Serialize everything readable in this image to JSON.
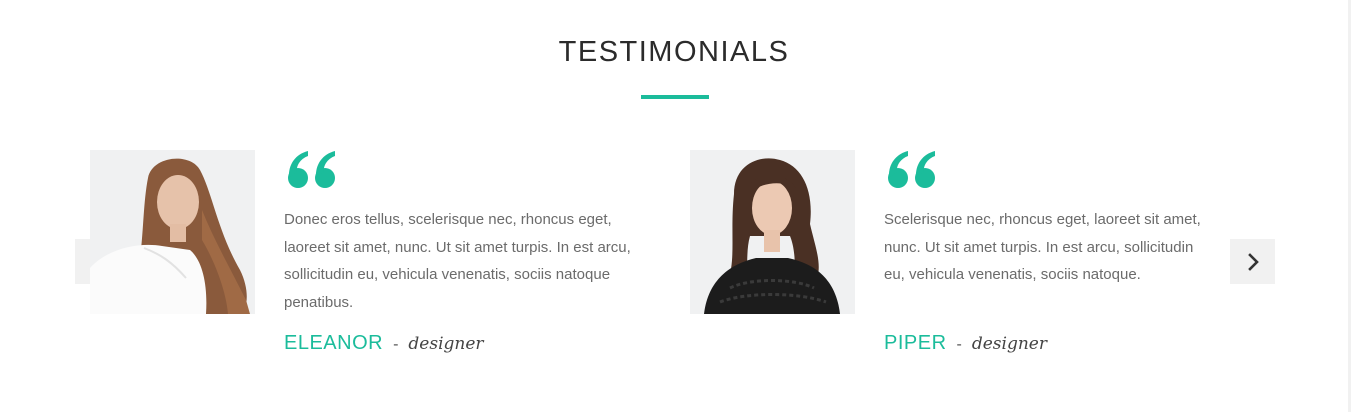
{
  "section": {
    "title": "TESTIMONIALS",
    "accent_color": "#1bbc9b"
  },
  "testimonials": [
    {
      "photo": "portrait-photo-woman-light-hair-white-blouse",
      "quote_icon": "quote-icon",
      "text": "Donec eros tellus, scelerisque nec, rhoncus eget, laoreet sit amet, nunc. Ut sit amet turpis. In est arcu, sollicitudin eu, vehicula venenatis, sociis natoque penatibus.",
      "name": "ELEANOR",
      "separator": "-",
      "role": "designer"
    },
    {
      "photo": "portrait-photo-woman-dark-hair-black-lace-top",
      "quote_icon": "quote-icon",
      "text": "Scelerisque nec, rhoncus eget, laoreet sit amet, nunc. Ut sit amet turpis. In est arcu, sollicitudin eu, vehicula venenatis, sociis natoque.",
      "name": "PIPER",
      "separator": "-",
      "role": "designer"
    }
  ],
  "carousel": {
    "prev_icon": "chevron-left-icon",
    "next_icon": "chevron-right-icon"
  }
}
